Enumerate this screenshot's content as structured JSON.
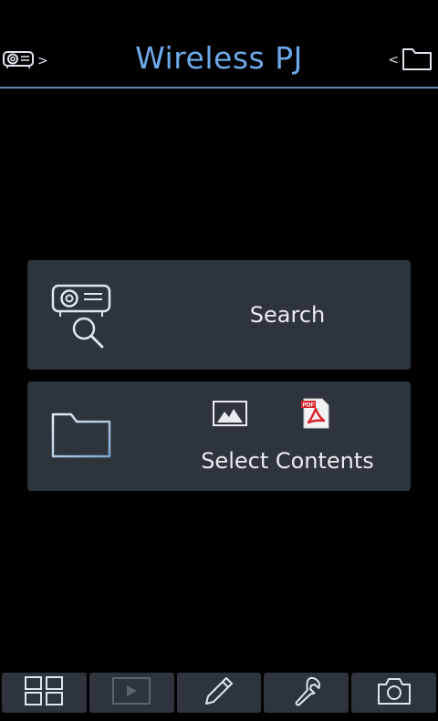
{
  "header": {
    "title": "Wireless PJ",
    "left_chevron": ">",
    "right_chevron": "<",
    "left_icon": "projector-icon",
    "right_icon": "folder-icon"
  },
  "cards": {
    "search": {
      "label": "Search",
      "icon": "projector-search-icon"
    },
    "contents": {
      "label": "Select Contents",
      "icon": "folder-icon",
      "types": [
        "image-icon",
        "pdf-icon"
      ],
      "pdf_badge": "PDF"
    }
  },
  "toolbar": {
    "items": [
      "grid-icon",
      "play-icon",
      "pencil-icon",
      "wrench-icon",
      "camera-icon"
    ]
  },
  "colors": {
    "accent": "#6ea9ea",
    "card_bg": "#2d343c",
    "background": "#000000",
    "pdf_red": "#d9262e"
  }
}
